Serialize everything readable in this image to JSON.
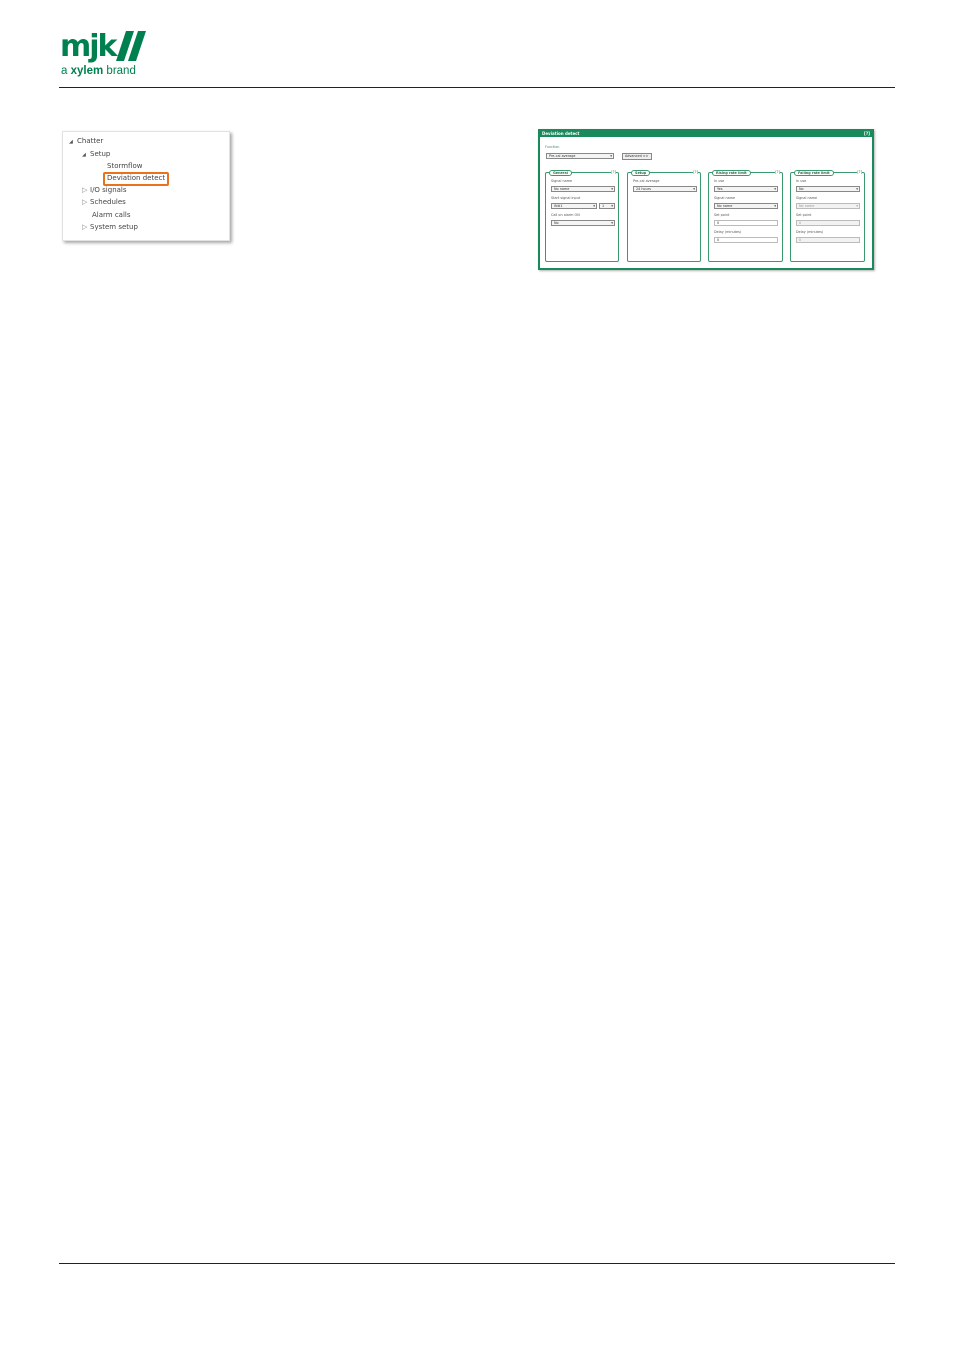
{
  "header": {
    "logo_mark": "mjk",
    "tagline_prefix": "a",
    "tagline_brand": "xylem",
    "tagline_suffix": "brand",
    "colors": {
      "brand_green": "#00804f",
      "highlight": "#e8731f",
      "window_green": "#1a8a5c"
    }
  },
  "tree": {
    "items": [
      {
        "label": "Chatter",
        "expander": "◢",
        "level": 0
      },
      {
        "label": "Setup",
        "expander": "◢",
        "level": 1
      },
      {
        "label": "Stormflow",
        "expander": "",
        "level": 2
      },
      {
        "label": "Deviation detect",
        "expander": "",
        "level": 2,
        "highlighted": true
      },
      {
        "label": "I/O signals",
        "expander": "▷",
        "level": 1
      },
      {
        "label": "Schedules",
        "expander": "▷",
        "level": 1
      },
      {
        "label": "Alarm calls",
        "expander": "",
        "level": 1
      },
      {
        "label": "System setup",
        "expander": "▷",
        "level": 1
      }
    ]
  },
  "deviation_window": {
    "title": "Deviation detect",
    "help": "[?]",
    "function_label": "Function",
    "function_value": "Pre-cal average",
    "advanced_button": "Advanced >>",
    "groups": {
      "general": {
        "title": "General",
        "help": "[?]",
        "signal_name_label": "Signal name",
        "signal_name_value": "No name",
        "start_signal_input_label": "Start signal input",
        "start_signal_input_value": "IN#1",
        "start_signal_input_sub": "1",
        "call_on_alarm_label": "Call on alarm ON",
        "call_on_alarm_value": "No"
      },
      "setup": {
        "title": "Setup",
        "help": "[?]",
        "pre_cal_label": "Pre-cal average",
        "pre_cal_value": "24 hours"
      },
      "rising": {
        "title": "Rising rate limit",
        "help": "[?]",
        "in_use_label": "In use",
        "in_use_value": "Yes",
        "signal_name_label": "Signal name",
        "signal_name_value": "No name",
        "set_point_label": "Set point",
        "set_point_value": "0",
        "delay_label": "Delay (minutes)",
        "delay_value": "0"
      },
      "falling": {
        "title": "Falling rate limit",
        "help": "[?]",
        "in_use_label": "In use",
        "in_use_value": "No",
        "signal_name_label": "Signal name",
        "signal_name_value": "No name",
        "set_point_label": "Set point",
        "set_point_value": "0",
        "delay_label": "Delay (minutes)",
        "delay_value": "0"
      }
    }
  }
}
